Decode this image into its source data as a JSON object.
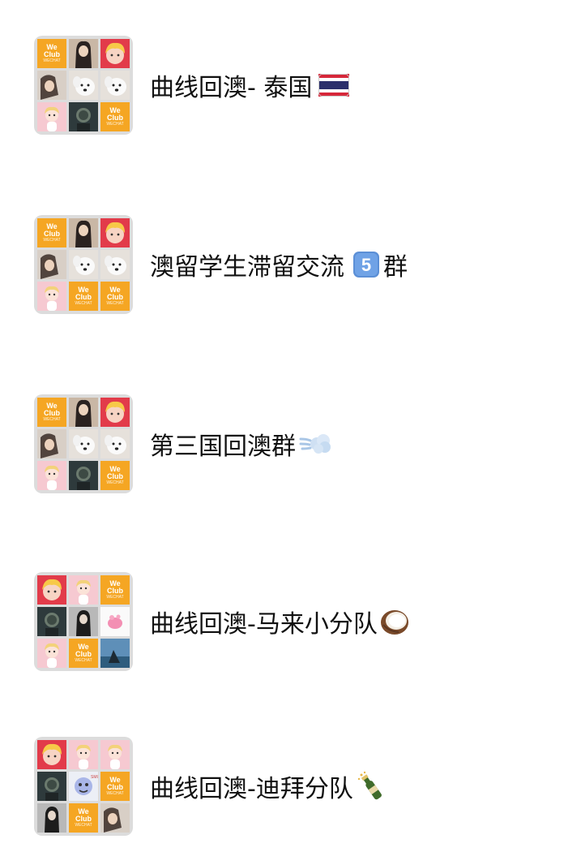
{
  "tile_text": {
    "line1": "We",
    "line2": "Club",
    "sub": "WECHAT"
  },
  "groups": [
    {
      "name": "曲线回澳- 泰国",
      "emoji": "thailand-flag-icon",
      "tiles": [
        "wechub",
        "photo-girl-long-hair",
        "cartoon-yellow-hair",
        "photo-girl-lying",
        "photo-dog-white",
        "photo-dog-white",
        "cartoon-pink-doll",
        "photo-dark-figure",
        "wechub"
      ]
    },
    {
      "name": "澳留学生滞留交流",
      "emoji": "keycap-5-icon",
      "suffix": "群",
      "tiles": [
        "wechub",
        "photo-girl-long-hair",
        "cartoon-yellow-hair",
        "photo-girl-lying",
        "photo-dog-white",
        "photo-dog-white",
        "cartoon-pink-doll",
        "wechub",
        "wechub"
      ]
    },
    {
      "name": "第三国回澳群",
      "emoji": "dash-cloud-icon",
      "tiles": [
        "wechub",
        "photo-girl-long-hair",
        "cartoon-yellow-hair",
        "photo-girl-lying",
        "photo-dog-white",
        "photo-dog-white",
        "cartoon-pink-doll",
        "photo-dark-figure",
        "wechub"
      ]
    },
    {
      "name": "曲线回澳-马来小分队",
      "emoji": "coconut-icon",
      "tiles": [
        "cartoon-yellow-hair",
        "cartoon-pink-doll",
        "wechub",
        "photo-dark-figure",
        "photo-girl-dark",
        "cartoon-pink-cup",
        "cartoon-pink-doll",
        "wechub",
        "photo-blue-sky"
      ]
    },
    {
      "name": "曲线回澳-迪拜分队",
      "emoji": "champagne-bottle-icon",
      "tiles": [
        "cartoon-yellow-hair",
        "cartoon-pink-doll",
        "cartoon-pink-doll",
        "photo-dark-figure",
        "cartoon-blue-toy",
        "wechub",
        "photo-girl-dark",
        "wechub",
        "photo-girl-lying"
      ]
    }
  ]
}
